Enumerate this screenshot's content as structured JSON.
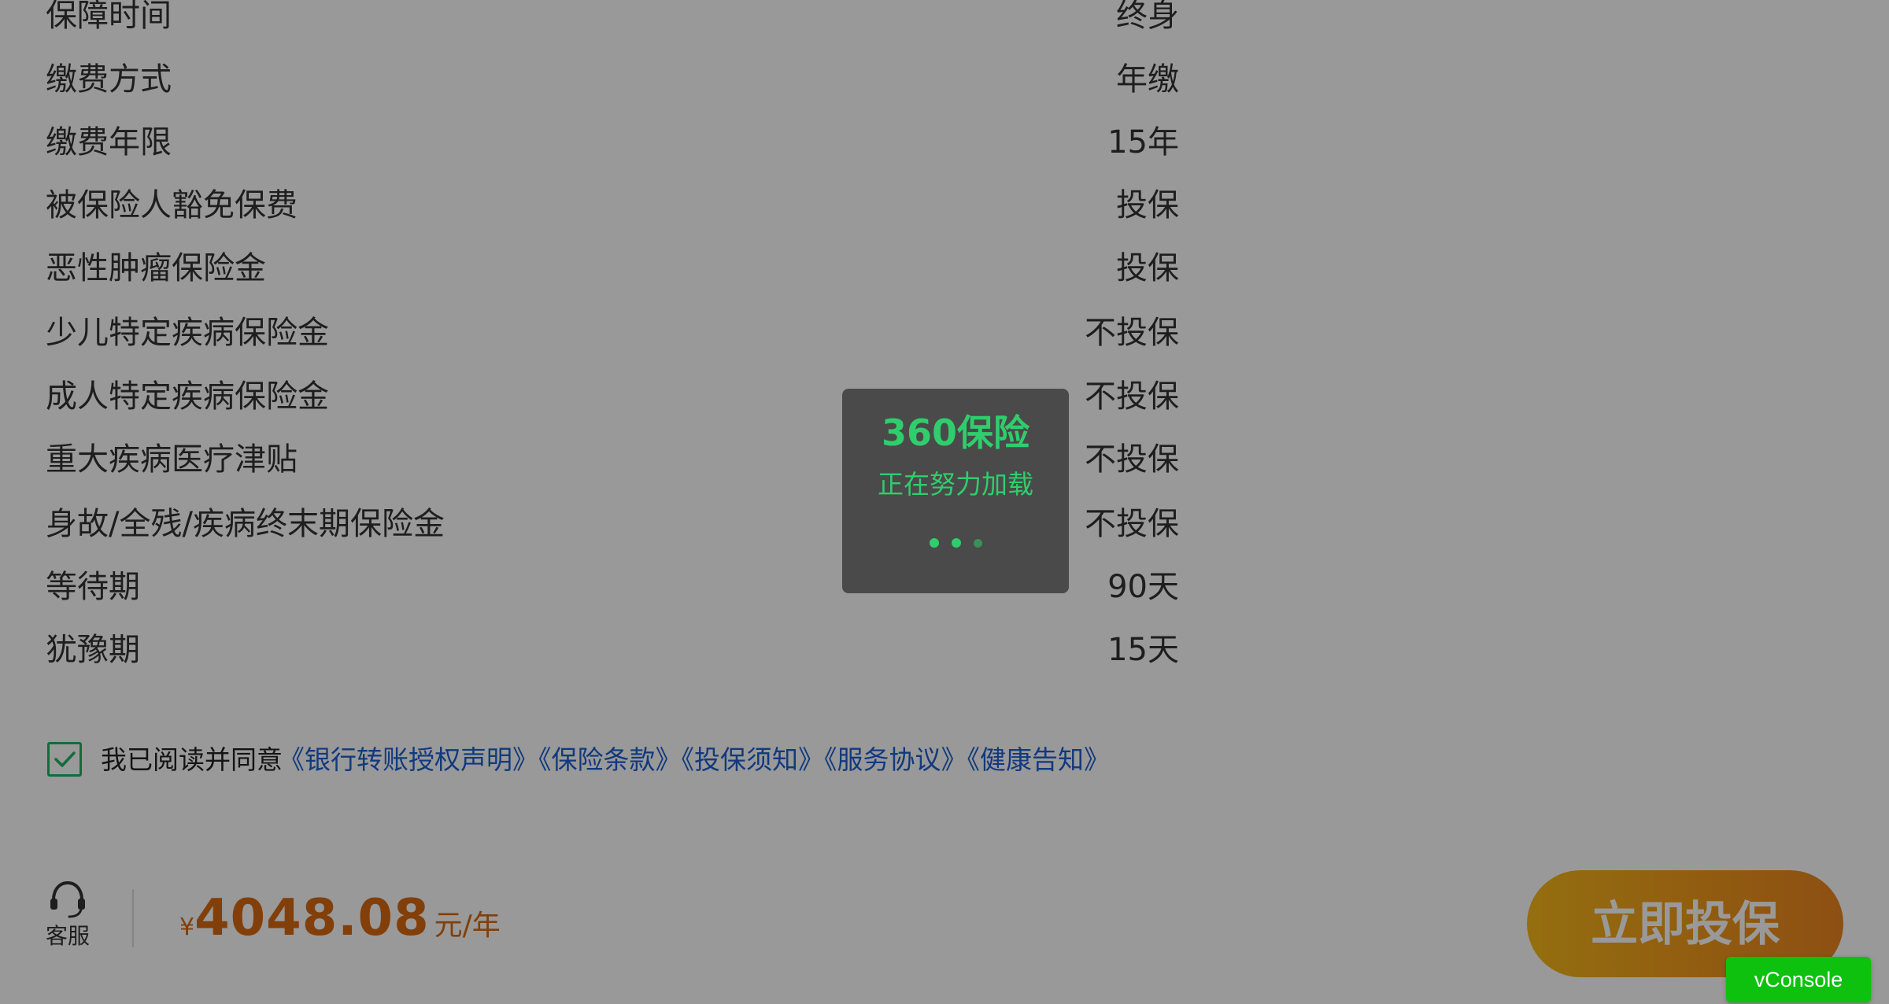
{
  "details": [
    {
      "label": "保障时间",
      "value": "终身"
    },
    {
      "label": "缴费方式",
      "value": "年缴"
    },
    {
      "label": "缴费年限",
      "value": "15年"
    },
    {
      "label": "被保险人豁免保费",
      "value": "投保"
    },
    {
      "label": "恶性肿瘤保险金",
      "value": "投保"
    },
    {
      "label": "少儿特定疾病保险金",
      "value": "不投保"
    },
    {
      "label": "成人特定疾病保险金",
      "value": "不投保"
    },
    {
      "label": "重大疾病医疗津贴",
      "value": "不投保"
    },
    {
      "label": "身故/全残/疾病终末期保险金",
      "value": "不投保"
    },
    {
      "label": "等待期",
      "value": "90天"
    },
    {
      "label": "犹豫期",
      "value": "15天"
    }
  ],
  "agreement": {
    "checked": true,
    "prefix": "我已阅读并同意",
    "links": [
      "《银行转账授权声明》",
      "《保险条款》",
      "《投保须知》",
      "《服务协议》",
      "《健康告知》"
    ]
  },
  "bottom_bar": {
    "service_label": "客服",
    "price_symbol": "¥",
    "price_amount": "4048.08",
    "price_unit": "元/年",
    "cta_label": "立即投保"
  },
  "loading": {
    "title": "360保险",
    "subtitle": "正在努力加载"
  },
  "vconsole_label": "vConsole",
  "colors": {
    "accent_green": "#2fce6c",
    "price_orange": "#d96a12",
    "link_blue": "#1f5fd0",
    "cta_gradient_start": "#f7b91a",
    "cta_gradient_end": "#ec8520",
    "vconsole_green": "#0ec10e"
  }
}
